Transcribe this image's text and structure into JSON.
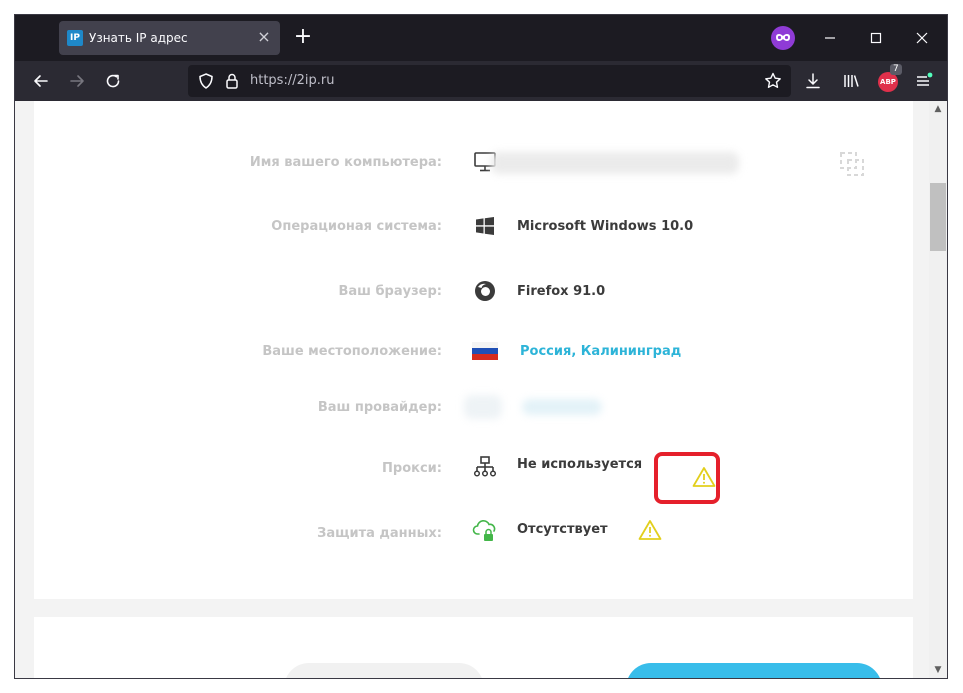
{
  "browser": {
    "tab_title": "Узнать IP адрес",
    "tab_favicon_text": "IP",
    "url": "https://2ip.ru",
    "extension_badge": "7",
    "extension_label": "ABP"
  },
  "rows": [
    {
      "label": "Имя вашего компьютера:",
      "value": "",
      "icon": "monitor-icon"
    },
    {
      "label": "Операционая система:",
      "value": "Microsoft Windows 10.0",
      "icon": "windows-icon"
    },
    {
      "label": "Ваш браузер:",
      "value": "Firefox 91.0",
      "icon": "firefox-icon"
    },
    {
      "label": "Ваше местоположение:",
      "value": "Россия, Калининград",
      "icon": "russia-flag-icon"
    },
    {
      "label": "Ваш провайдер:",
      "value": "",
      "icon": "provider-icon"
    },
    {
      "label": "Прокси:",
      "value": "Не используется",
      "icon": "network-icon"
    },
    {
      "label": "Защита данных:",
      "value": "Отсутствует",
      "icon": "cloud-lock-icon"
    }
  ],
  "colors": {
    "warning": "#e2cf1d",
    "highlight": "#e5202b",
    "link": "#2db4d8"
  }
}
